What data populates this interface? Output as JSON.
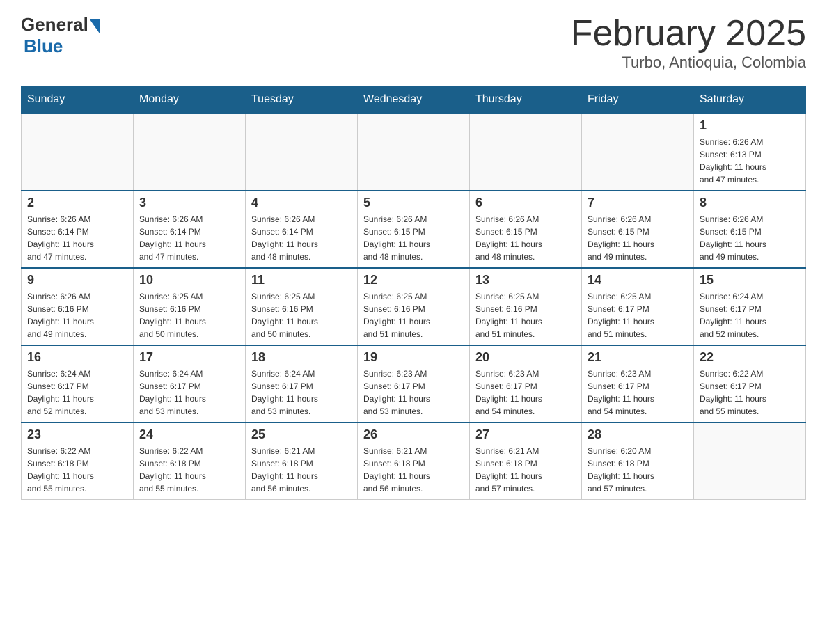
{
  "logo": {
    "general": "General",
    "blue": "Blue"
  },
  "title": "February 2025",
  "subtitle": "Turbo, Antioquia, Colombia",
  "weekdays": [
    "Sunday",
    "Monday",
    "Tuesday",
    "Wednesday",
    "Thursday",
    "Friday",
    "Saturday"
  ],
  "weeks": [
    [
      {
        "day": "",
        "info": ""
      },
      {
        "day": "",
        "info": ""
      },
      {
        "day": "",
        "info": ""
      },
      {
        "day": "",
        "info": ""
      },
      {
        "day": "",
        "info": ""
      },
      {
        "day": "",
        "info": ""
      },
      {
        "day": "1",
        "info": "Sunrise: 6:26 AM\nSunset: 6:13 PM\nDaylight: 11 hours\nand 47 minutes."
      }
    ],
    [
      {
        "day": "2",
        "info": "Sunrise: 6:26 AM\nSunset: 6:14 PM\nDaylight: 11 hours\nand 47 minutes."
      },
      {
        "day": "3",
        "info": "Sunrise: 6:26 AM\nSunset: 6:14 PM\nDaylight: 11 hours\nand 47 minutes."
      },
      {
        "day": "4",
        "info": "Sunrise: 6:26 AM\nSunset: 6:14 PM\nDaylight: 11 hours\nand 48 minutes."
      },
      {
        "day": "5",
        "info": "Sunrise: 6:26 AM\nSunset: 6:15 PM\nDaylight: 11 hours\nand 48 minutes."
      },
      {
        "day": "6",
        "info": "Sunrise: 6:26 AM\nSunset: 6:15 PM\nDaylight: 11 hours\nand 48 minutes."
      },
      {
        "day": "7",
        "info": "Sunrise: 6:26 AM\nSunset: 6:15 PM\nDaylight: 11 hours\nand 49 minutes."
      },
      {
        "day": "8",
        "info": "Sunrise: 6:26 AM\nSunset: 6:15 PM\nDaylight: 11 hours\nand 49 minutes."
      }
    ],
    [
      {
        "day": "9",
        "info": "Sunrise: 6:26 AM\nSunset: 6:16 PM\nDaylight: 11 hours\nand 49 minutes."
      },
      {
        "day": "10",
        "info": "Sunrise: 6:25 AM\nSunset: 6:16 PM\nDaylight: 11 hours\nand 50 minutes."
      },
      {
        "day": "11",
        "info": "Sunrise: 6:25 AM\nSunset: 6:16 PM\nDaylight: 11 hours\nand 50 minutes."
      },
      {
        "day": "12",
        "info": "Sunrise: 6:25 AM\nSunset: 6:16 PM\nDaylight: 11 hours\nand 51 minutes."
      },
      {
        "day": "13",
        "info": "Sunrise: 6:25 AM\nSunset: 6:16 PM\nDaylight: 11 hours\nand 51 minutes."
      },
      {
        "day": "14",
        "info": "Sunrise: 6:25 AM\nSunset: 6:17 PM\nDaylight: 11 hours\nand 51 minutes."
      },
      {
        "day": "15",
        "info": "Sunrise: 6:24 AM\nSunset: 6:17 PM\nDaylight: 11 hours\nand 52 minutes."
      }
    ],
    [
      {
        "day": "16",
        "info": "Sunrise: 6:24 AM\nSunset: 6:17 PM\nDaylight: 11 hours\nand 52 minutes."
      },
      {
        "day": "17",
        "info": "Sunrise: 6:24 AM\nSunset: 6:17 PM\nDaylight: 11 hours\nand 53 minutes."
      },
      {
        "day": "18",
        "info": "Sunrise: 6:24 AM\nSunset: 6:17 PM\nDaylight: 11 hours\nand 53 minutes."
      },
      {
        "day": "19",
        "info": "Sunrise: 6:23 AM\nSunset: 6:17 PM\nDaylight: 11 hours\nand 53 minutes."
      },
      {
        "day": "20",
        "info": "Sunrise: 6:23 AM\nSunset: 6:17 PM\nDaylight: 11 hours\nand 54 minutes."
      },
      {
        "day": "21",
        "info": "Sunrise: 6:23 AM\nSunset: 6:17 PM\nDaylight: 11 hours\nand 54 minutes."
      },
      {
        "day": "22",
        "info": "Sunrise: 6:22 AM\nSunset: 6:17 PM\nDaylight: 11 hours\nand 55 minutes."
      }
    ],
    [
      {
        "day": "23",
        "info": "Sunrise: 6:22 AM\nSunset: 6:18 PM\nDaylight: 11 hours\nand 55 minutes."
      },
      {
        "day": "24",
        "info": "Sunrise: 6:22 AM\nSunset: 6:18 PM\nDaylight: 11 hours\nand 55 minutes."
      },
      {
        "day": "25",
        "info": "Sunrise: 6:21 AM\nSunset: 6:18 PM\nDaylight: 11 hours\nand 56 minutes."
      },
      {
        "day": "26",
        "info": "Sunrise: 6:21 AM\nSunset: 6:18 PM\nDaylight: 11 hours\nand 56 minutes."
      },
      {
        "day": "27",
        "info": "Sunrise: 6:21 AM\nSunset: 6:18 PM\nDaylight: 11 hours\nand 57 minutes."
      },
      {
        "day": "28",
        "info": "Sunrise: 6:20 AM\nSunset: 6:18 PM\nDaylight: 11 hours\nand 57 minutes."
      },
      {
        "day": "",
        "info": ""
      }
    ]
  ]
}
